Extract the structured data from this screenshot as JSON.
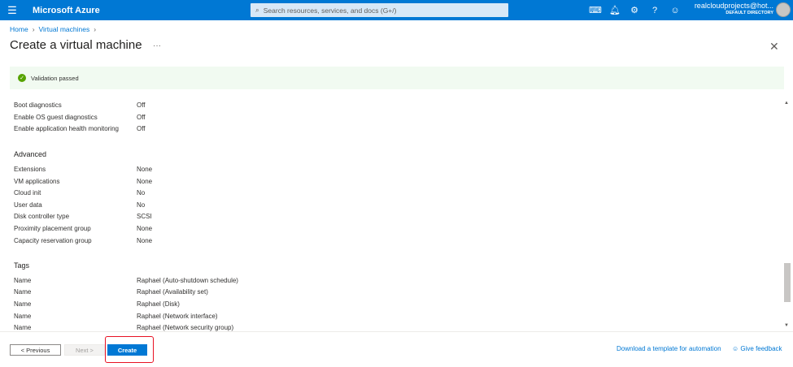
{
  "header": {
    "brand": "Microsoft Azure",
    "search_placeholder": "Search resources, services, and docs (G+/)",
    "account_name": "realcloudprojects@hot...",
    "account_directory": "DEFAULT DIRECTORY",
    "icons": [
      "cloud-shell-icon",
      "bell-icon",
      "gear-icon",
      "help-icon",
      "feedback-icon"
    ]
  },
  "breadcrumb": [
    "Home",
    "Virtual machines"
  ],
  "page_title": "Create a virtual machine",
  "validation": "Validation passed",
  "monitoring": [
    {
      "k": "Boot diagnostics",
      "v": "Off"
    },
    {
      "k": "Enable OS guest diagnostics",
      "v": "Off"
    },
    {
      "k": "Enable application health monitoring",
      "v": "Off"
    }
  ],
  "advanced": {
    "title": "Advanced",
    "rows": [
      {
        "k": "Extensions",
        "v": "None"
      },
      {
        "k": "VM applications",
        "v": "None"
      },
      {
        "k": "Cloud init",
        "v": "No"
      },
      {
        "k": "User data",
        "v": "No"
      },
      {
        "k": "Disk controller type",
        "v": "SCSI"
      },
      {
        "k": "Proximity placement group",
        "v": "None"
      },
      {
        "k": "Capacity reservation group",
        "v": "None"
      }
    ]
  },
  "tags": {
    "title": "Tags",
    "rows": [
      {
        "k": "Name",
        "v": "Raphael (Auto-shutdown schedule)"
      },
      {
        "k": "Name",
        "v": "Raphael (Availability set)"
      },
      {
        "k": "Name",
        "v": "Raphael (Disk)"
      },
      {
        "k": "Name",
        "v": "Raphael (Network interface)"
      },
      {
        "k": "Name",
        "v": "Raphael (Network security group)"
      }
    ]
  },
  "footer": {
    "previous": "< Previous",
    "next": "Next >",
    "create": "Create",
    "download": "Download a template for automation",
    "feedback": "Give feedback"
  }
}
